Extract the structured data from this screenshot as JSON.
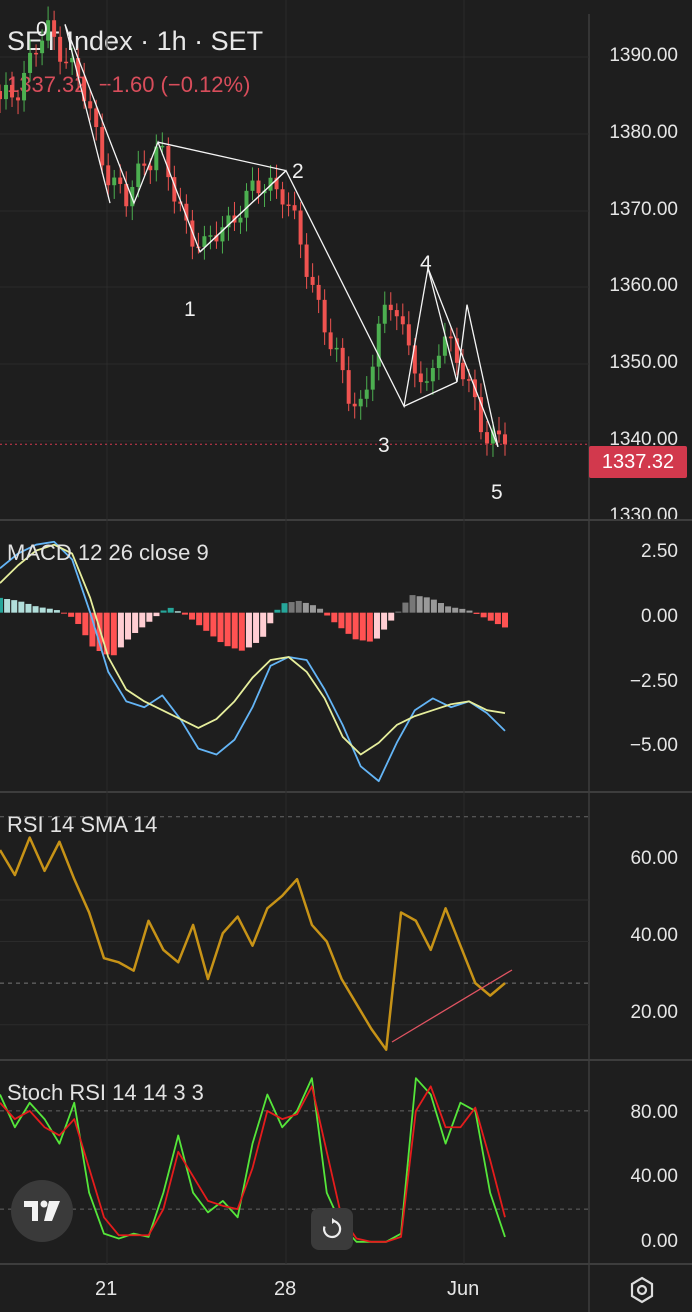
{
  "header": {
    "title": "SET Index · 1h · SET",
    "last": "1337.32",
    "change": "−1.60 (−0.12%)"
  },
  "colors": {
    "bull": "#4caf50",
    "bear": "#ef5350",
    "macd_line": "#64b5f6",
    "signal_line": "#e6ee9c",
    "rsi_line": "#c79317",
    "stoch_k": "#55e63a",
    "stoch_d": "#e51c1c",
    "price_tag": "#d2394d"
  },
  "price_axis": {
    "ticks": [
      "1390.00",
      "1380.00",
      "1370.00",
      "1360.00",
      "1350.00",
      "1340.00",
      "1330.00"
    ],
    "current": "1337.32"
  },
  "macd": {
    "label": "MACD 12 26 close 9",
    "ticks": [
      "2.50",
      "0.00",
      "−2.50",
      "−5.00"
    ]
  },
  "rsi": {
    "label": "RSI 14 SMA 14",
    "ticks": [
      "60.00",
      "40.00",
      "20.00"
    ]
  },
  "stoch": {
    "label": "Stoch RSI 14 14 3 3",
    "ticks": [
      "80.00",
      "40.00",
      "0.00"
    ]
  },
  "x_axis": {
    "labels": [
      "21",
      "28",
      "Jun"
    ]
  },
  "wave_labels": [
    "0",
    "1",
    "2",
    "3",
    "4",
    "5"
  ],
  "chart_data": [
    {
      "type": "line",
      "title": "SET Index · 1h · SET",
      "ylim": [
        1328,
        1392
      ],
      "series": [
        {
          "values": [
            1379,
            1381,
            1385,
            1388,
            1386,
            1382,
            1376,
            1370,
            1367,
            1372,
            1374,
            1368,
            1364,
            1361,
            1364,
            1366,
            1368,
            1370,
            1368,
            1362,
            1356,
            1349,
            1344,
            1342,
            1351,
            1356,
            1348,
            1343,
            1352,
            1347,
            1343,
            1338,
            1337.32
          ]
        }
      ],
      "annotations": [
        {
          "label": "0",
          "value": 1389
        },
        {
          "label": "1",
          "value": 1361
        },
        {
          "label": "2",
          "value": 1371
        },
        {
          "label": "3",
          "value": 1342
        },
        {
          "label": "4",
          "value": 1359
        },
        {
          "label": "5",
          "value": 1337
        }
      ]
    },
    {
      "type": "line",
      "title": "MACD 12 26 close 9",
      "ylim": [
        -6,
        3
      ],
      "series": [
        {
          "name": "MACD",
          "values": [
            1.5,
            2.0,
            2.3,
            2.4,
            1.8,
            0.0,
            -2.0,
            -3.0,
            -3.2,
            -2.8,
            -3.6,
            -4.6,
            -4.8,
            -4.3,
            -3.2,
            -1.8,
            -1.5,
            -1.6,
            -2.6,
            -3.8,
            -5.2,
            -5.7,
            -4.4,
            -3.3,
            -2.9,
            -3.2,
            -3.0,
            -3.4,
            -4.0
          ]
        },
        {
          "name": "Signal",
          "values": [
            1.0,
            1.6,
            2.1,
            2.3,
            2.0,
            0.5,
            -1.5,
            -2.6,
            -3.0,
            -3.3,
            -3.6,
            -3.9,
            -3.6,
            -3.0,
            -2.2,
            -1.6,
            -1.5,
            -2.0,
            -2.9,
            -4.2,
            -4.8,
            -4.4,
            -3.8,
            -3.5,
            -3.3,
            -3.1,
            -3.0,
            -3.3,
            -3.4
          ]
        },
        {
          "name": "Histogram",
          "values": [
            0.5,
            0.4,
            0.2,
            0.1,
            -0.2,
            -1.2,
            -1.5,
            -0.8,
            -0.3,
            0.2,
            -0.1,
            -0.6,
            -1.1,
            -1.3,
            -0.9,
            0.3,
            0.4,
            0.2,
            -0.4,
            -0.9,
            -1.0,
            -0.2,
            0.6,
            0.5,
            0.2,
            0.1,
            -0.2,
            -0.5
          ]
        }
      ]
    },
    {
      "type": "line",
      "title": "RSI 14 SMA 14",
      "ylim": [
        12,
        75
      ],
      "series": [
        {
          "name": "RSI",
          "values": [
            62,
            56,
            65,
            57,
            64,
            55,
            47,
            36,
            35,
            33,
            45,
            38,
            35,
            44,
            31,
            42,
            46,
            39,
            48,
            51,
            55,
            44,
            40,
            31,
            25,
            19,
            14,
            47,
            45,
            38,
            48,
            39,
            30,
            27,
            30
          ]
        }
      ]
    },
    {
      "type": "line",
      "title": "Stoch RSI 14 14 3 3",
      "ylim": [
        -5,
        105
      ],
      "series": [
        {
          "name": "K",
          "values": [
            90,
            70,
            85,
            75,
            60,
            85,
            30,
            5,
            2,
            5,
            3,
            30,
            65,
            30,
            18,
            25,
            15,
            60,
            90,
            70,
            80,
            100,
            30,
            10,
            0,
            0,
            0,
            5,
            100,
            90,
            60,
            85,
            80,
            30,
            3
          ]
        },
        {
          "name": "D",
          "values": [
            85,
            75,
            80,
            70,
            65,
            75,
            45,
            15,
            4,
            4,
            4,
            20,
            55,
            40,
            25,
            22,
            20,
            45,
            80,
            75,
            78,
            95,
            55,
            15,
            2,
            0,
            0,
            3,
            80,
            95,
            70,
            70,
            82,
            50,
            15
          ]
        }
      ]
    }
  ]
}
